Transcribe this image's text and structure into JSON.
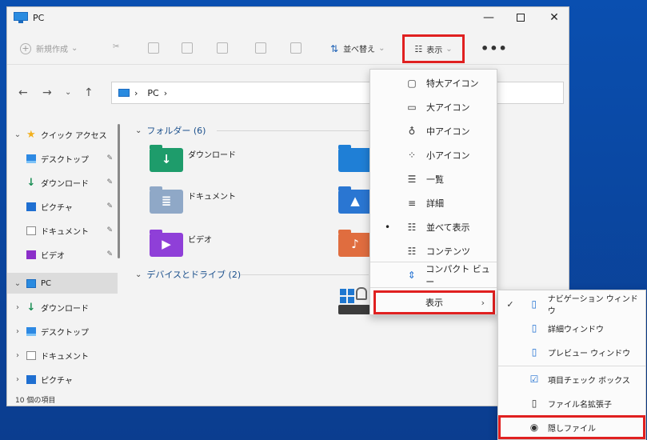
{
  "window": {
    "title": "PC"
  },
  "toolbar": {
    "new_label": "新規作成",
    "sort_label": "並べ替え",
    "view_label": "表示",
    "more_label": "•••"
  },
  "address": {
    "segment": "PC",
    "separator": "›"
  },
  "sidebar": {
    "items": [
      {
        "label": "クイック アクセス",
        "icon": "star-icon",
        "expanded": true
      },
      {
        "label": "デスクトップ",
        "icon": "desktop-icon",
        "pinned": true
      },
      {
        "label": "ダウンロード",
        "icon": "download-icon",
        "pinned": true
      },
      {
        "label": "ピクチャ",
        "icon": "pictures-icon",
        "pinned": true
      },
      {
        "label": "ドキュメント",
        "icon": "documents-icon",
        "pinned": true
      },
      {
        "label": "ビデオ",
        "icon": "videos-icon",
        "pinned": true
      },
      {
        "label": "PC",
        "icon": "pc-icon",
        "expanded": true,
        "selected": true
      },
      {
        "label": "ダウンロード",
        "icon": "download-icon"
      },
      {
        "label": "デスクトップ",
        "icon": "desktop-icon"
      },
      {
        "label": "ドキュメント",
        "icon": "documents-icon"
      },
      {
        "label": "ピクチャ",
        "icon": "pictures-icon"
      }
    ],
    "pin_glyph": "📌"
  },
  "status": {
    "text": "10 個の項目"
  },
  "content": {
    "folders_header": "フォルダー (6)",
    "folders": [
      {
        "label": "ダウンロード"
      },
      {
        "label": "ドキュメント"
      },
      {
        "label": "ビデオ"
      }
    ],
    "drives_header": "デバイスとドライブ (2)"
  },
  "view_menu": {
    "items": [
      {
        "label": "特大アイコン",
        "icon": "monitor-icon",
        "glyph": "▢"
      },
      {
        "label": "大アイコン",
        "icon": "monitor-icon",
        "glyph": "▭"
      },
      {
        "label": "中アイコン",
        "icon": "monitor-icon",
        "glyph": "♁"
      },
      {
        "label": "小アイコン",
        "icon": "small-icons-icon",
        "glyph": "⁘"
      },
      {
        "label": "一覧",
        "icon": "list-icon",
        "glyph": "☰"
      },
      {
        "label": "詳細",
        "icon": "details-icon",
        "glyph": "≡"
      },
      {
        "label": "並べて表示",
        "icon": "tiles-icon",
        "glyph": "☷",
        "selected": true
      },
      {
        "label": "コンテンツ",
        "icon": "content-icon",
        "glyph": "☷"
      },
      {
        "label": "コンパクト ビュー",
        "icon": "compact-icon",
        "glyph": "⇕"
      }
    ],
    "submenu_label": "表示",
    "bullet": "•"
  },
  "show_submenu": {
    "items": [
      {
        "label": "ナビゲーション ウィンドウ",
        "icon": "nav-pane-icon",
        "glyph": "▯",
        "checked": true
      },
      {
        "label": "詳細ウィンドウ",
        "icon": "details-pane-icon",
        "glyph": "▯"
      },
      {
        "label": "プレビュー ウィンドウ",
        "icon": "preview-pane-icon",
        "glyph": "▯"
      },
      {
        "label": "項目チェック ボックス",
        "icon": "checkbox-icon",
        "glyph": "☑"
      },
      {
        "label": "ファイル名拡張子",
        "icon": "file-ext-icon",
        "glyph": "▯"
      },
      {
        "label": "隠しファイル",
        "icon": "eye-icon",
        "glyph": "◉"
      }
    ],
    "check_glyph": "✓"
  },
  "colors": {
    "accent": "#1f6fd1",
    "highlight_border": "#e02020",
    "desktop": "#0a4fb0"
  }
}
